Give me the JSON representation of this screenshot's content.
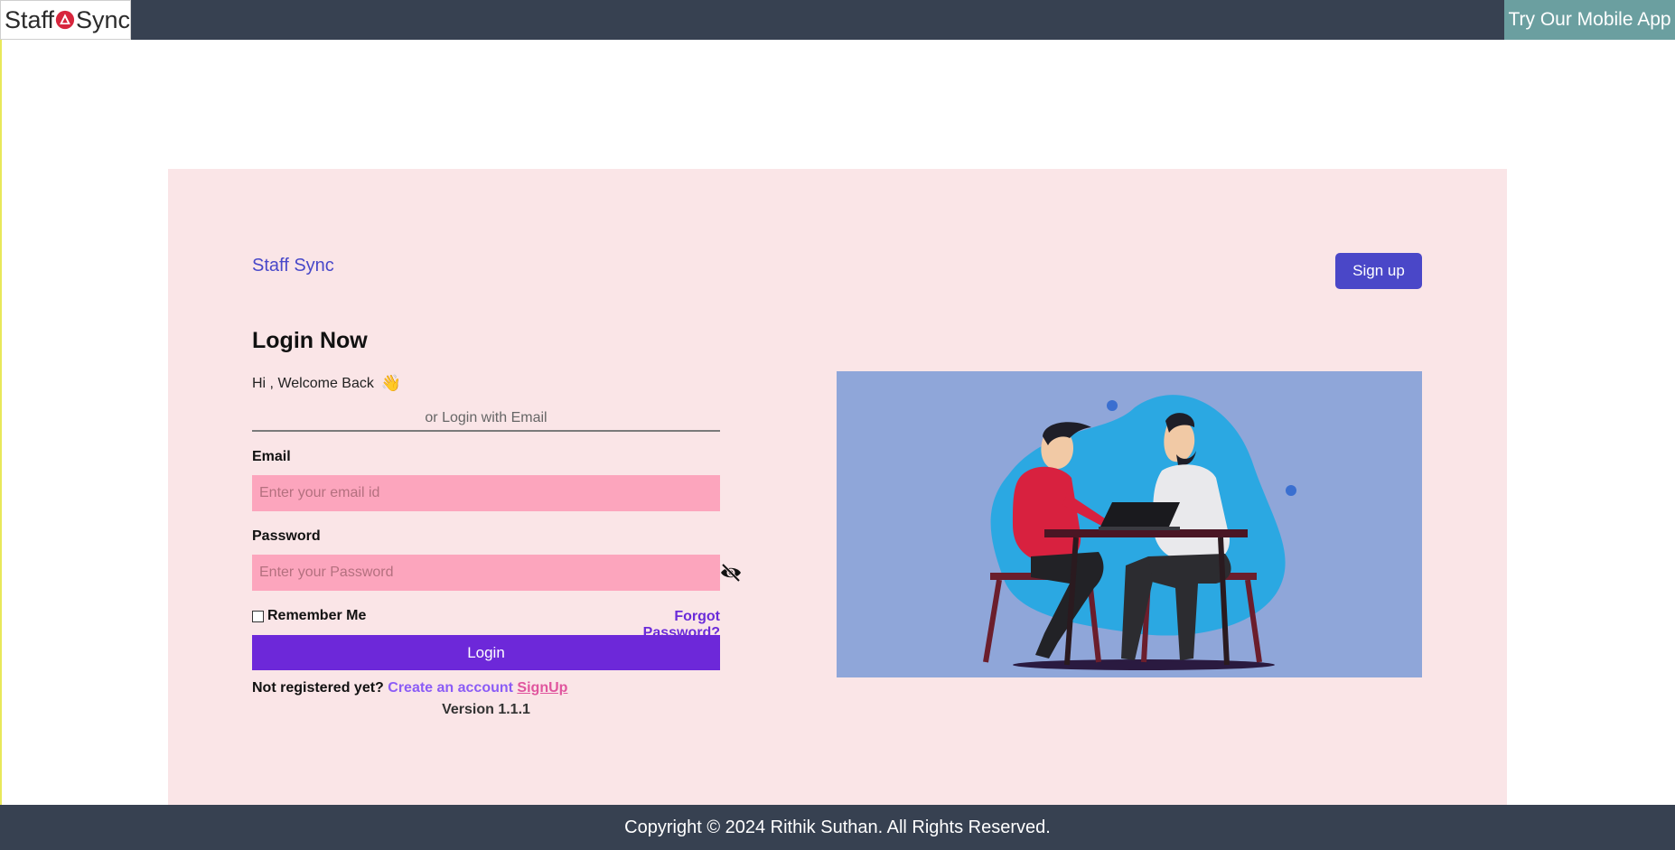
{
  "topbar": {
    "logo_left": "Staff",
    "logo_right": "Sync",
    "mobile_app_label": "Try Our Mobile App"
  },
  "card": {
    "brand": "Staff Sync",
    "signup_button": "Sign up"
  },
  "login": {
    "title": "Login Now",
    "welcome": "Hi , Welcome Back",
    "wave_icon": "👋",
    "or_login": "or Login with Email",
    "email_label": "Email",
    "email_placeholder": "Enter your email id",
    "password_label": "Password",
    "password_placeholder": "Enter your Password",
    "remember_label": "Remember Me",
    "forgot_label": "Forgot Password?",
    "login_button": "Login",
    "not_registered": "Not registered yet? ",
    "create_account": "Create an account ",
    "signup_link": "SignUp",
    "version": "Version 1.1.1"
  },
  "footer": {
    "copyright": "Copyright © 2024 Rithik Suthan. All Rights Reserved."
  },
  "colors": {
    "topbar": "#374151",
    "card_bg": "#fae5e7",
    "brand": "#4848c9",
    "input_bg": "#fca5bd",
    "login_btn": "#6d28d9",
    "illustration_bg": "#8fa6d9"
  },
  "icons": {
    "password_toggle": "eye-slash-icon",
    "wave": "waving-hand-icon",
    "logo_mark": "triangle-logo-icon"
  }
}
